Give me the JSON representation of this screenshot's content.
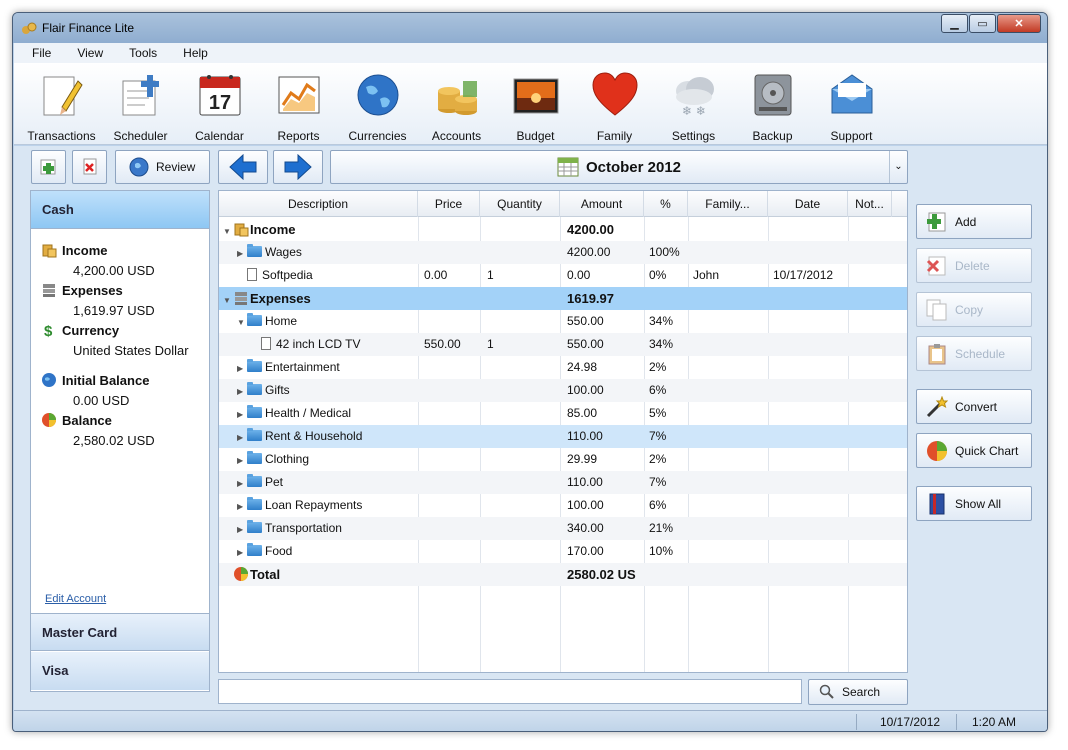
{
  "window": {
    "title": "Flair Finance Lite"
  },
  "menu": [
    "File",
    "View",
    "Tools",
    "Help"
  ],
  "toolbar": [
    {
      "label": "Transactions",
      "icon": "pencil-paper-icon"
    },
    {
      "label": "Scheduler",
      "icon": "scheduler-icon"
    },
    {
      "label": "Calendar",
      "icon": "calendar-icon",
      "day": "17"
    },
    {
      "label": "Reports",
      "icon": "reports-icon"
    },
    {
      "label": "Currencies",
      "icon": "globe-icon"
    },
    {
      "label": "Accounts",
      "icon": "coins-icon"
    },
    {
      "label": "Budget",
      "icon": "budget-icon"
    },
    {
      "label": "Family",
      "icon": "heart-icon"
    },
    {
      "label": "Settings",
      "icon": "settings-icon"
    },
    {
      "label": "Backup",
      "icon": "backup-icon"
    },
    {
      "label": "Support",
      "icon": "envelope-icon"
    }
  ],
  "review_label": "Review",
  "period": "October 2012",
  "accounts": {
    "active": "Cash",
    "others": [
      "Master Card",
      "Visa"
    ],
    "edit_link": "Edit Account"
  },
  "summary": {
    "income_label": "Income",
    "income_value": "4,200.00 USD",
    "expenses_label": "Expenses",
    "expenses_value": "1,619.97 USD",
    "currency_label": "Currency",
    "currency_value": "United States Dollar",
    "initial_label": "Initial Balance",
    "initial_value": "0.00 USD",
    "balance_label": "Balance",
    "balance_value": "2,580.02 USD"
  },
  "columns": [
    "Description",
    "Price",
    "Quantity",
    "Amount",
    "%",
    "Family...",
    "Date",
    "Not..."
  ],
  "rows": [
    {
      "kind": "group",
      "icon": "coins",
      "expand": "▼",
      "indent": 0,
      "desc": "Income",
      "price": "",
      "qty": "",
      "amount": "4200.00",
      "pct": "",
      "family": "",
      "date": ""
    },
    {
      "kind": "folder",
      "expand": "▶",
      "indent": 1,
      "desc": "Wages",
      "price": "",
      "qty": "",
      "amount": "4200.00",
      "pct": "100%",
      "family": "",
      "date": ""
    },
    {
      "kind": "doc",
      "expand": "",
      "indent": 1,
      "desc": "Softpedia",
      "price": "0.00",
      "qty": "1",
      "amount": "0.00",
      "pct": "0%",
      "family": "John",
      "date": "10/17/2012"
    },
    {
      "kind": "group",
      "icon": "disks",
      "expand": "▼",
      "indent": 0,
      "desc": "Expenses",
      "price": "",
      "qty": "",
      "amount": "1619.97",
      "pct": "",
      "family": "",
      "date": "",
      "selected": true
    },
    {
      "kind": "folder",
      "expand": "▼",
      "indent": 1,
      "desc": "Home",
      "price": "",
      "qty": "",
      "amount": "550.00",
      "pct": "34%",
      "family": "",
      "date": ""
    },
    {
      "kind": "doc",
      "expand": "",
      "indent": 2,
      "desc": "42 inch LCD TV",
      "price": "550.00",
      "qty": "1",
      "amount": "550.00",
      "pct": "34%",
      "family": "",
      "date": ""
    },
    {
      "kind": "folder",
      "expand": "▶",
      "indent": 1,
      "desc": "Entertainment",
      "price": "",
      "qty": "",
      "amount": "24.98",
      "pct": "2%",
      "family": "",
      "date": ""
    },
    {
      "kind": "folder",
      "expand": "▶",
      "indent": 1,
      "desc": "Gifts",
      "price": "",
      "qty": "",
      "amount": "100.00",
      "pct": "6%",
      "family": "",
      "date": ""
    },
    {
      "kind": "folder",
      "expand": "▶",
      "indent": 1,
      "desc": "Health / Medical",
      "price": "",
      "qty": "",
      "amount": "85.00",
      "pct": "5%",
      "family": "",
      "date": ""
    },
    {
      "kind": "folder",
      "expand": "▶",
      "indent": 1,
      "desc": "Rent & Household",
      "price": "",
      "qty": "",
      "amount": "110.00",
      "pct": "7%",
      "family": "",
      "date": "",
      "hover": true
    },
    {
      "kind": "folder",
      "expand": "▶",
      "indent": 1,
      "desc": "Clothing",
      "price": "",
      "qty": "",
      "amount": "29.99",
      "pct": "2%",
      "family": "",
      "date": ""
    },
    {
      "kind": "folder",
      "expand": "▶",
      "indent": 1,
      "desc": "Pet",
      "price": "",
      "qty": "",
      "amount": "110.00",
      "pct": "7%",
      "family": "",
      "date": ""
    },
    {
      "kind": "folder",
      "expand": "▶",
      "indent": 1,
      "desc": "Loan Repayments",
      "price": "",
      "qty": "",
      "amount": "100.00",
      "pct": "6%",
      "family": "",
      "date": ""
    },
    {
      "kind": "folder",
      "expand": "▶",
      "indent": 1,
      "desc": "Transportation",
      "price": "",
      "qty": "",
      "amount": "340.00",
      "pct": "21%",
      "family": "",
      "date": ""
    },
    {
      "kind": "folder",
      "expand": "▶",
      "indent": 1,
      "desc": "Food",
      "price": "",
      "qty": "",
      "amount": "170.00",
      "pct": "10%",
      "family": "",
      "date": ""
    },
    {
      "kind": "group",
      "icon": "pie",
      "expand": "",
      "indent": 0,
      "desc": "Total",
      "price": "",
      "qty": "",
      "amount": "2580.02 US",
      "pct": "",
      "family": "",
      "date": ""
    }
  ],
  "actions": {
    "add": "Add",
    "delete": "Delete",
    "copy": "Copy",
    "schedule": "Schedule",
    "convert": "Convert",
    "quick_chart": "Quick Chart",
    "show_all": "Show All"
  },
  "search": {
    "button": "Search",
    "value": ""
  },
  "status": {
    "date": "10/17/2012",
    "time": "1:20 AM"
  }
}
